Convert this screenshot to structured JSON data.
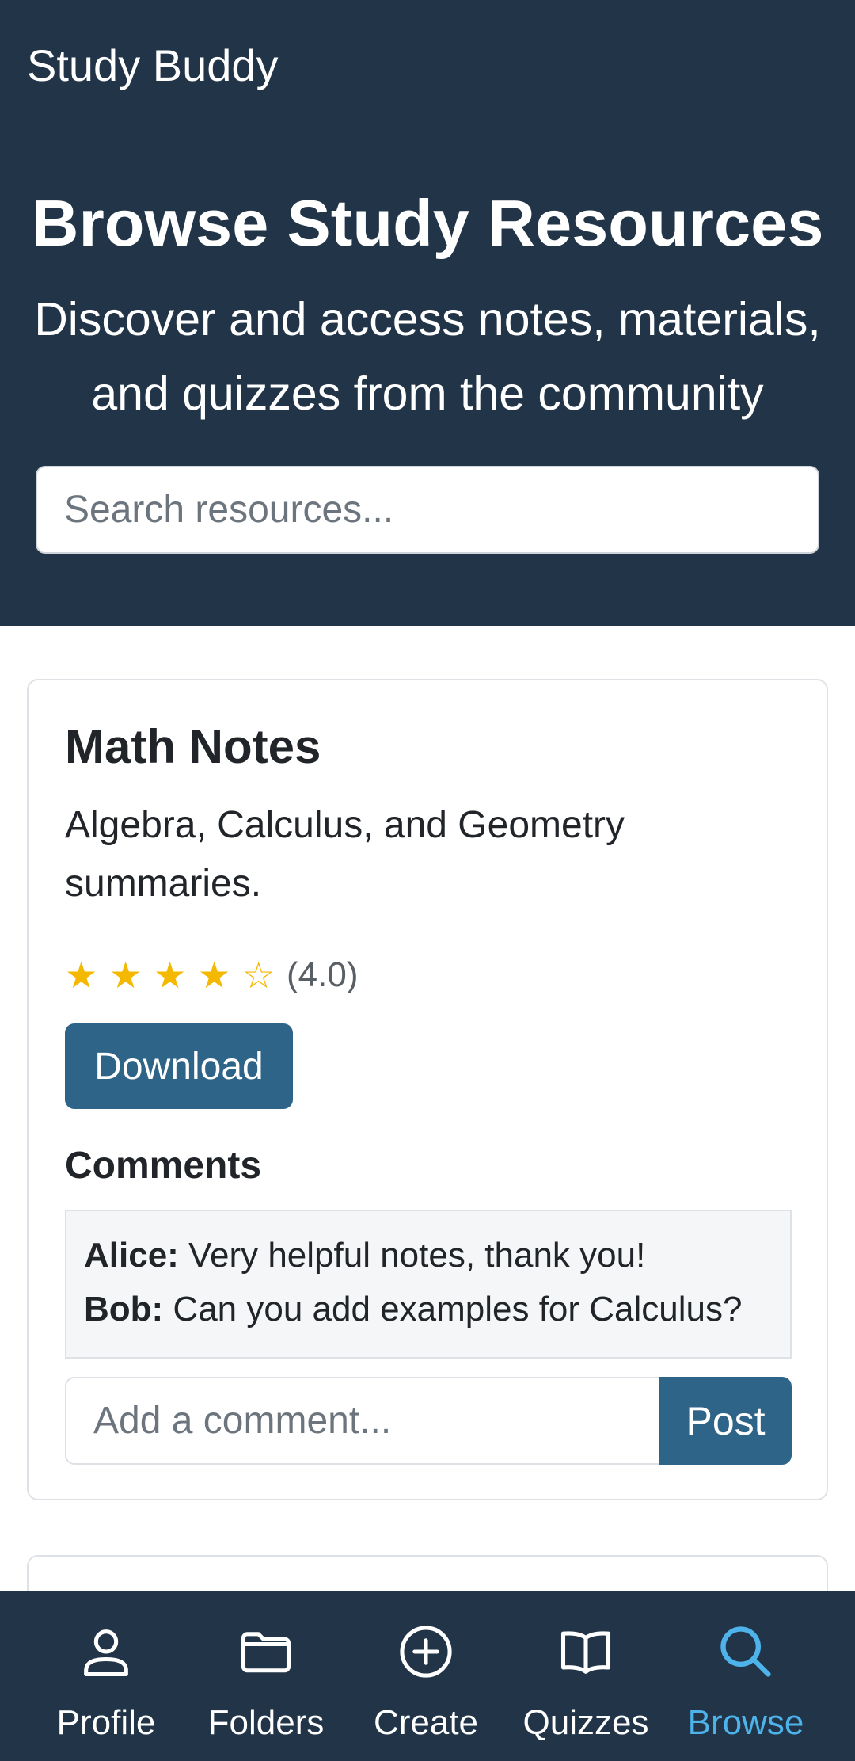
{
  "header": {
    "brand": "Study Buddy",
    "title": "Browse Study Resources",
    "subtitle": "Discover and access notes, materials, and quizzes from the community",
    "search_placeholder": "Search resources..."
  },
  "resources": [
    {
      "title": "Math Notes",
      "description": "Algebra, Calculus, and Geometry summaries.",
      "rating": 4.0,
      "rating_label": "(4.0)",
      "stars": [
        "★",
        "★",
        "★",
        "★",
        "☆"
      ],
      "download_label": "Download",
      "comments_heading": "Comments",
      "comments": [
        {
          "author": "Alice:",
          "text": "Very helpful notes, thank you!"
        },
        {
          "author": "Bob:",
          "text": "Can you add examples for Calculus?"
        }
      ],
      "comment_placeholder": "Add a comment...",
      "post_label": "Post"
    }
  ],
  "bottom_nav": {
    "items": [
      {
        "label": "Profile",
        "icon": "person-icon"
      },
      {
        "label": "Folders",
        "icon": "folder-icon"
      },
      {
        "label": "Create",
        "icon": "plus-circle-icon"
      },
      {
        "label": "Quizzes",
        "icon": "book-icon"
      },
      {
        "label": "Browse",
        "icon": "search-icon"
      }
    ],
    "active": "Browse"
  },
  "colors": {
    "header_bg": "#223447",
    "accent": "#2e6488",
    "active_nav": "#4db3ea",
    "star": "#f5b800"
  }
}
